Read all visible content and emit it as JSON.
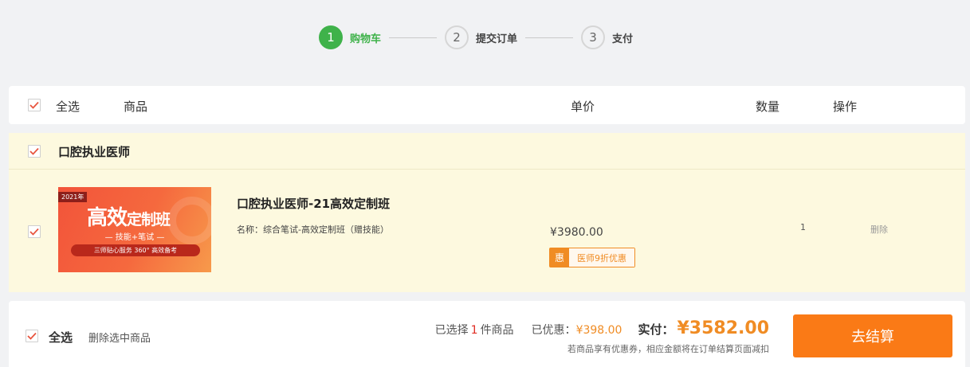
{
  "steps": [
    {
      "num": "1",
      "label": "购物车"
    },
    {
      "num": "2",
      "label": "提交订单"
    },
    {
      "num": "3",
      "label": "支付"
    }
  ],
  "header": {
    "select_all": "全选",
    "product": "商品",
    "unit_price": "单价",
    "quantity": "数量",
    "action": "操作"
  },
  "group": {
    "title": "口腔执业医师"
  },
  "item": {
    "image": {
      "year": "2021年",
      "title_a": "高效",
      "title_b": "定制班",
      "subtitle": "— 技能+笔试 —",
      "bar": "三师贴心服务  360°  高效备考"
    },
    "name": "口腔执业医师-21高效定制班",
    "spec": "名称：综合笔试-高效定制班（赠技能）",
    "price": "¥3980.00",
    "discount_badge": "惠",
    "discount_text": "医师9折优惠",
    "quantity": "1",
    "delete_label": "删除"
  },
  "footer": {
    "select_all": "全选",
    "delete_selected": "删除选中商品",
    "selected_prefix": "已选择",
    "selected_count": "1",
    "selected_suffix": "件商品",
    "saved_label": "已优惠：",
    "saved_value": "¥398.00",
    "pay_label": "实付：",
    "pay_value": "¥3582.00",
    "note": "若商品享有优惠券，相应金额将在订单结算页面减扣",
    "checkout_label": "去结算"
  },
  "colors": {
    "accent_green": "#3fb24a",
    "accent_orange": "#fa7a16",
    "checkbox_tick": "#e8553f"
  }
}
